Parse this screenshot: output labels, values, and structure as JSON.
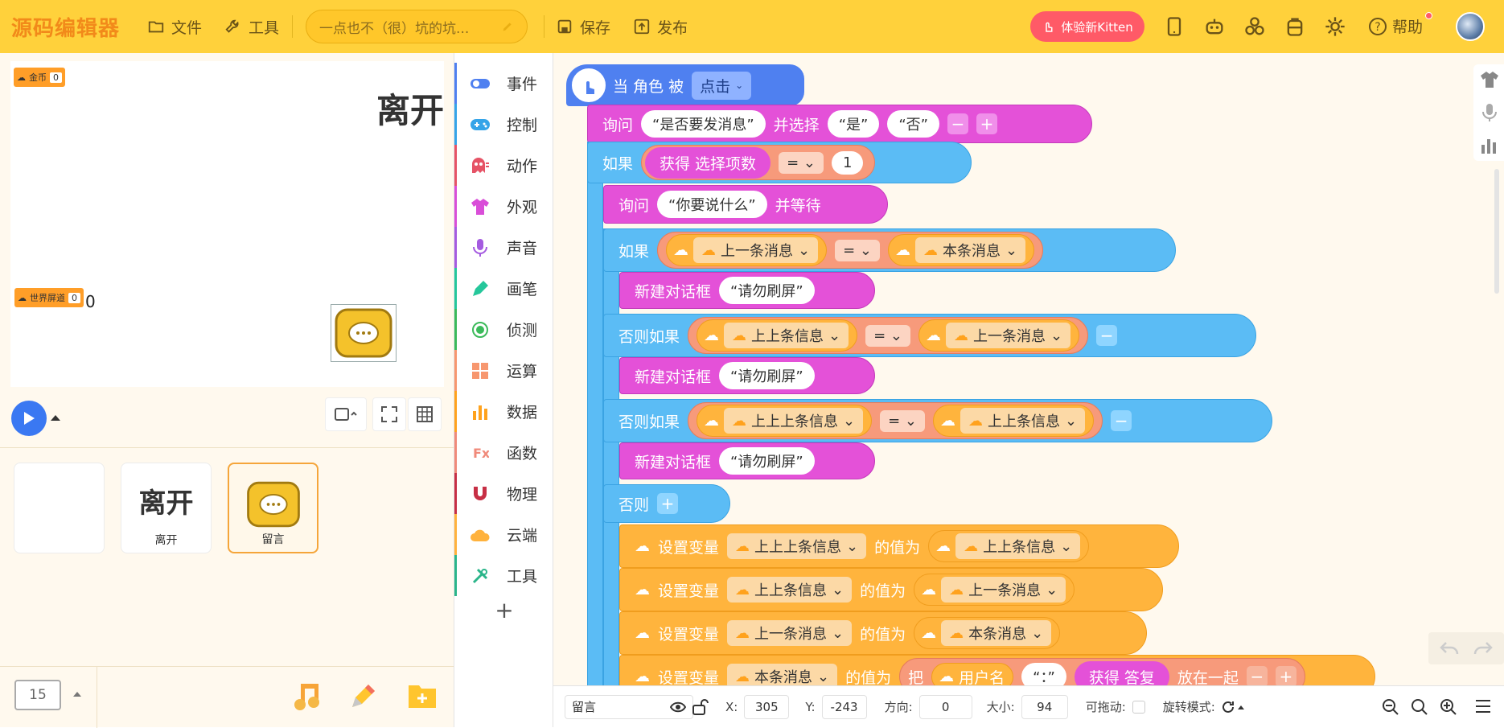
{
  "topbar": {
    "logo": "源码编辑器",
    "file_label": "文件",
    "tools_label": "工具",
    "project_title": "一点也不（很）坑的坑...",
    "save_label": "保存",
    "publish_label": "发布",
    "kitten_label": "体验新Kitten",
    "help_label": "帮助"
  },
  "stage": {
    "vars": [
      {
        "name": "金币",
        "value": "0"
      },
      {
        "name": "世界屏道",
        "value": "0"
      }
    ],
    "zero_text": "0",
    "leave_text": "离开"
  },
  "sprites": [
    {
      "label": ""
    },
    {
      "label": "离开"
    },
    {
      "label": "留言"
    }
  ],
  "scene_number": "15",
  "categories": [
    {
      "label": "事件",
      "color": "#4f80f0"
    },
    {
      "label": "控制",
      "color": "#35a4e8"
    },
    {
      "label": "动作",
      "color": "#e65366"
    },
    {
      "label": "外观",
      "color": "#d94ed8"
    },
    {
      "label": "声音",
      "color": "#a55be0"
    },
    {
      "label": "画笔",
      "color": "#25c79b"
    },
    {
      "label": "侦测",
      "color": "#3bba5a"
    },
    {
      "label": "运算",
      "color": "#f7976f"
    },
    {
      "label": "数据",
      "color": "#ffa21d"
    },
    {
      "label": "函数",
      "color": "#f08a7a"
    },
    {
      "label": "物理",
      "color": "#c72f45"
    },
    {
      "label": "云端",
      "color": "#ffb23d"
    },
    {
      "label": "工具",
      "color": "#2bb58a"
    }
  ],
  "blocks": {
    "hat": "当 角色 被",
    "hat_option": "点击",
    "ask": "询问",
    "ask_q1": "是否要发消息",
    "ask_choose": "并选择",
    "ask_yes": "是",
    "ask_no": "否",
    "if": "如果",
    "get_choice": "获得 选择项数",
    "eq": "=",
    "one": "1",
    "ask_q2": "你要说什么",
    "ask_wait": "并等待",
    "last_msg": "上一条消息",
    "this_msg": "本条消息",
    "last2_msg": "上上条信息",
    "last3_msg": "上上上条信息",
    "new_dialog": "新建对话框",
    "no_spam": "请勿刷屏",
    "else_if": "否则如果",
    "else": "否则",
    "set_var": "设置变量",
    "value_of": "的值为",
    "put": "把",
    "username": "用户名",
    "colon": "：",
    "get_answer": "获得 答复",
    "join": "放在一起"
  },
  "props": {
    "sprite_name": "留言",
    "x_label": "X:",
    "x": "305",
    "y_label": "Y:",
    "y": "-243",
    "dir_label": "方向:",
    "dir": "0",
    "size_label": "大小:",
    "size": "94",
    "drag_label": "可拖动:",
    "rotate_label": "旋转模式:"
  }
}
